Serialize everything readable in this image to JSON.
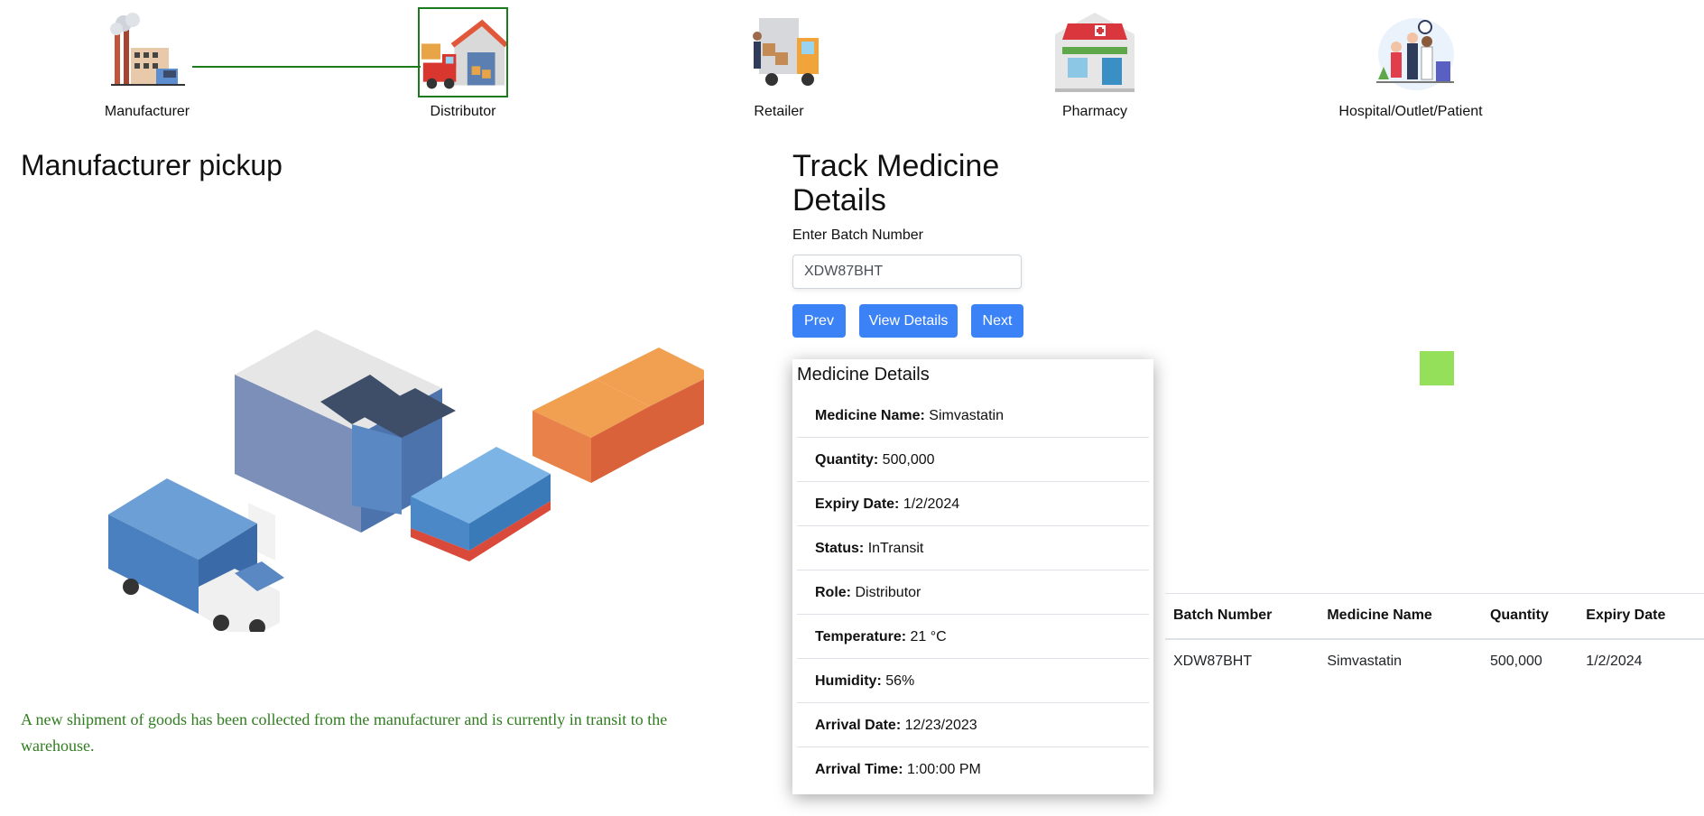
{
  "stages": [
    {
      "label": "Manufacturer",
      "icon": "factory-icon"
    },
    {
      "label": "Distributor",
      "icon": "warehouse-delivery-icon"
    },
    {
      "label": "Retailer",
      "icon": "delivery-truck-icon"
    },
    {
      "label": "Pharmacy",
      "icon": "pharmacy-store-icon"
    },
    {
      "label": "Hospital/Outlet/Patient",
      "icon": "doctor-patient-icon"
    }
  ],
  "active_stage": "Distributor",
  "left_panel": {
    "heading": "Manufacturer pickup",
    "message": "A new shipment of goods has been collected from the manufacturer and is currently in transit to the warehouse."
  },
  "track": {
    "heading": "Track Medicine Details",
    "input_label": "Enter Batch Number",
    "input_value": "XDW87BHT",
    "buttons": {
      "prev": "Prev",
      "view": "View Details",
      "next": "Next"
    }
  },
  "details": {
    "title": "Medicine Details",
    "fields": [
      {
        "label": "Medicine Name:",
        "value": "Simvastatin"
      },
      {
        "label": "Quantity:",
        "value": "500,000"
      },
      {
        "label": "Expiry Date:",
        "value": "1/2/2024"
      },
      {
        "label": "Status:",
        "value": "InTransit"
      },
      {
        "label": "Role:",
        "value": "Distributor"
      },
      {
        "label": "Temperature:",
        "value": "21 °C"
      },
      {
        "label": "Humidity:",
        "value": "56%"
      },
      {
        "label": "Arrival Date:",
        "value": "12/23/2023"
      },
      {
        "label": "Arrival Time:",
        "value": "1:00:00 PM"
      }
    ]
  },
  "indicator_color": "#95e05a",
  "table": {
    "headers": [
      "Batch Number",
      "Medicine Name",
      "Quantity",
      "Expiry Date"
    ],
    "rows": [
      [
        "XDW87BHT",
        "Simvastatin",
        "500,000",
        "1/2/2024"
      ]
    ]
  }
}
